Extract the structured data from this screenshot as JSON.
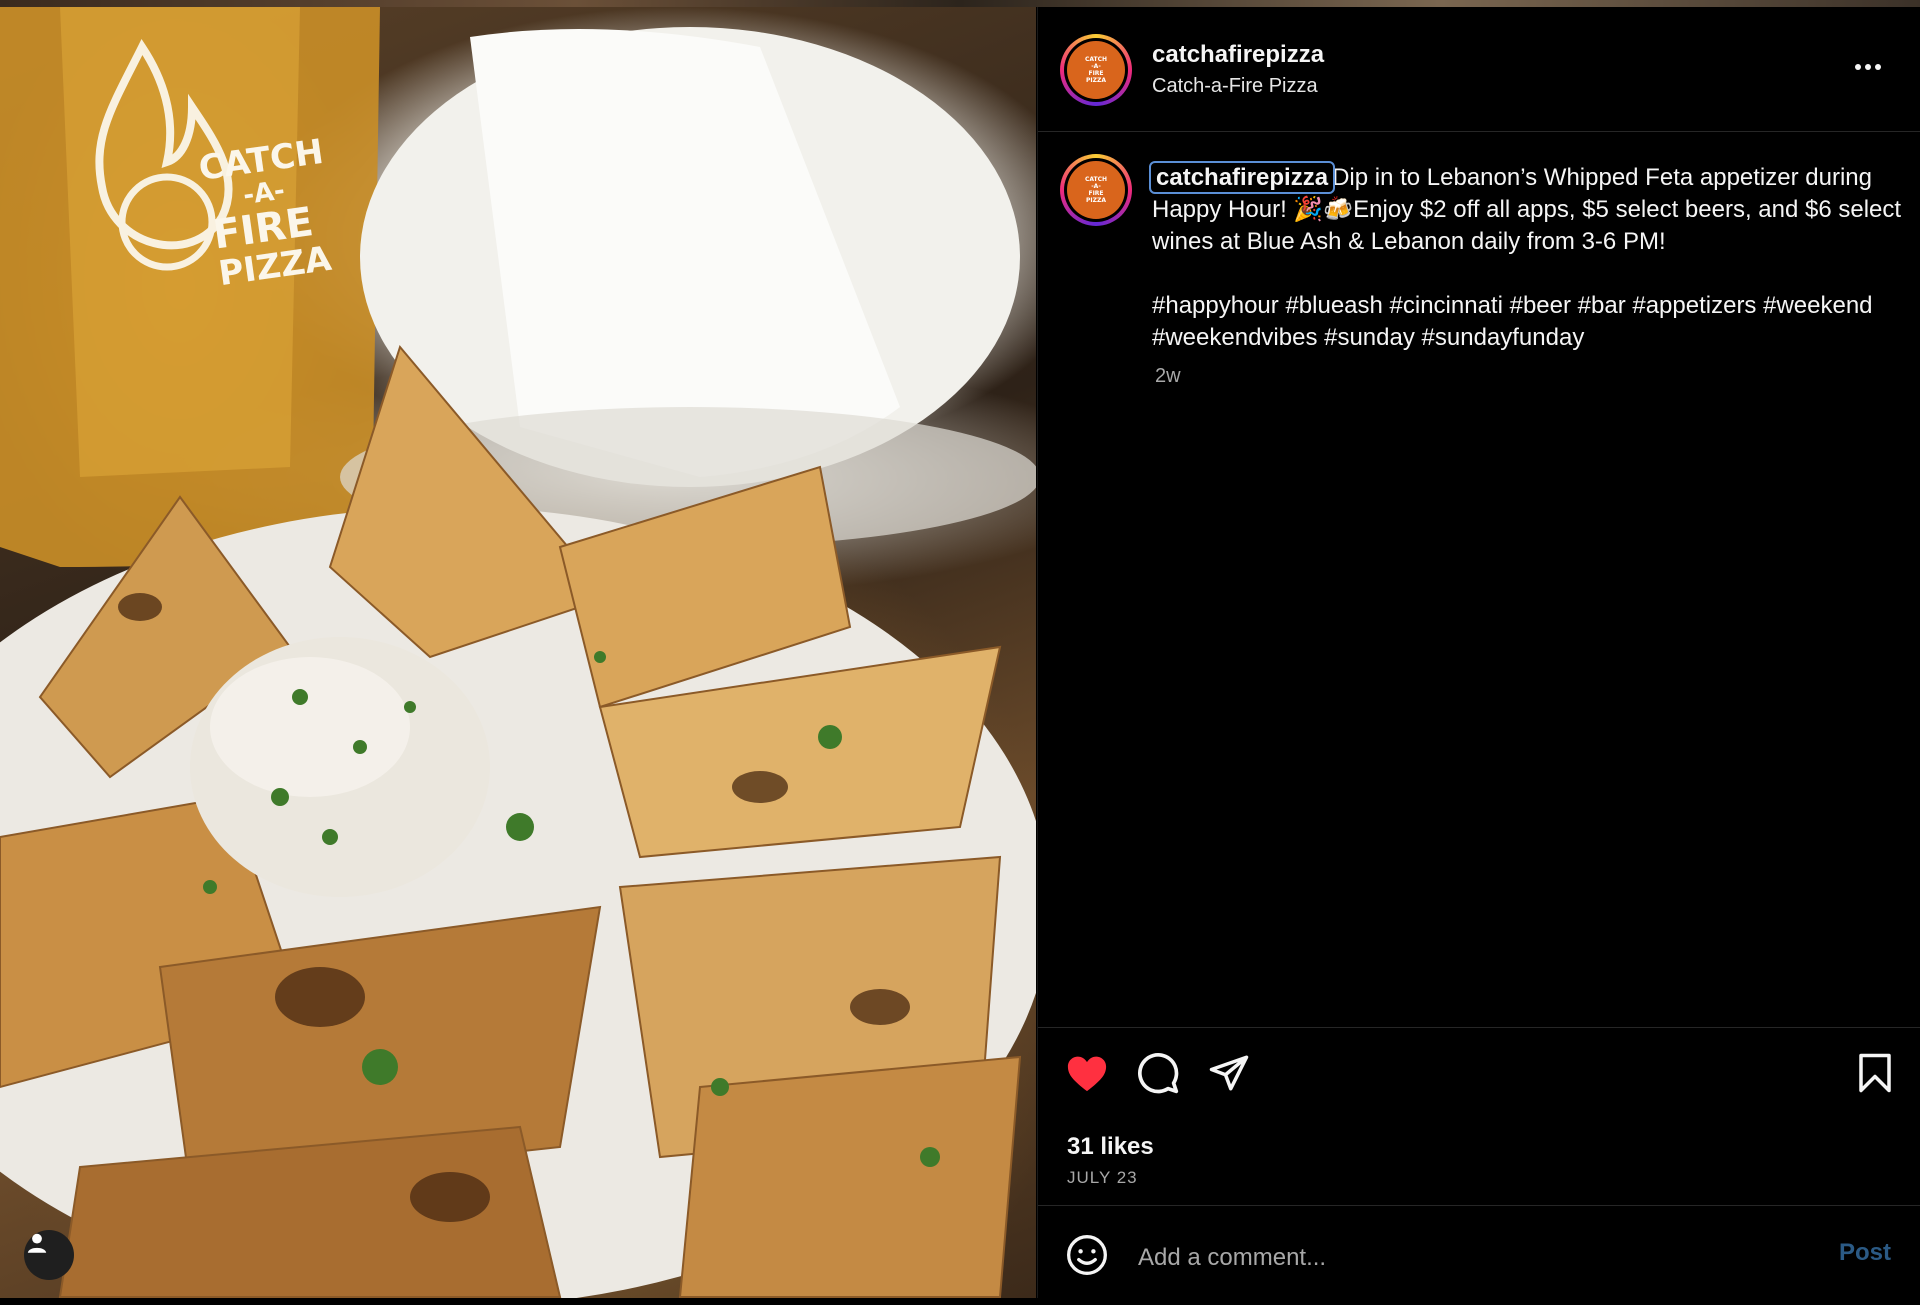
{
  "profile": {
    "username": "catchafirepizza",
    "display_name": "Catch-a-Fire Pizza",
    "logo_lines": [
      "CATCH",
      "-A-",
      "FIRE",
      "PIZZA"
    ]
  },
  "photo": {
    "glass_logo_lines": [
      "CATCH",
      "-A-",
      "FIRE",
      "PIZZA"
    ]
  },
  "caption": {
    "author": "catchafirepizza",
    "text": "Dip in to Lebanon’s Whipped Feta appetizer during Happy Hour! 🎉🍻Enjoy $2 off all apps, $5 select beers, and $6 select wines at Blue Ash & Lebanon daily from 3-6 PM!",
    "hashtags": "#happyhour #blueash #cincinnati #beer #bar #appetizers #weekend #weekendvibes #sunday #sundayfunday",
    "time_ago": "2w"
  },
  "engagement": {
    "likes_label": "31 likes",
    "date_label": "JULY 23",
    "liked": true
  },
  "comment": {
    "placeholder": "Add a comment...",
    "post_label": "Post"
  },
  "icons": {
    "like": "heart-icon",
    "comment": "comment-icon",
    "share": "share-icon",
    "save": "bookmark-icon",
    "emoji": "emoji-icon",
    "more": "more-icon",
    "user_tag": "user-icon"
  },
  "colors": {
    "heart": "#ff3040",
    "post_button": "#2b5a85",
    "logo_orange": "#d9651c",
    "secondary_text": "#a8a8a8"
  }
}
